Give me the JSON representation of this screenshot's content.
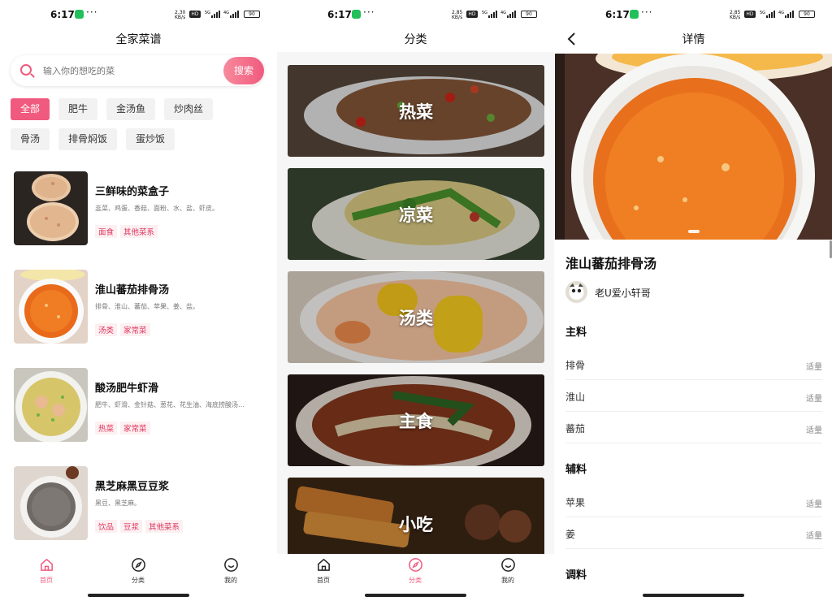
{
  "status": [
    {
      "time": "6:17",
      "dots": "···",
      "net": "2.30\nKB/s",
      "hd": "HD",
      "battery": "90",
      "sig1": "5G",
      "sig2": "4G"
    },
    {
      "time": "6:17",
      "dots": "···",
      "net": "2.85\nKB/s",
      "hd": "HD",
      "battery": "90",
      "sig1": "5G",
      "sig2": "4G"
    },
    {
      "time": "6:17",
      "dots": "···",
      "net": "2.85\nKB/s",
      "hd": "HD",
      "battery": "90",
      "sig1": "5G",
      "sig2": "4G"
    }
  ],
  "home": {
    "title": "全家菜谱",
    "search_placeholder": "输入你的想吃的菜",
    "search_button": "搜索",
    "chips": [
      "全部",
      "肥牛",
      "金汤鱼",
      "炒肉丝",
      "骨汤",
      "排骨焖饭",
      "蛋炒饭"
    ],
    "recipes": [
      {
        "name": "三鲜味的菜盒子",
        "ingredients": "韭菜、鸡蛋、香菇、面粉、水、盐、虾皮。",
        "tags": [
          "面食",
          "其他菜系"
        ]
      },
      {
        "name": "淮山蕃茄排骨汤",
        "ingredients": "排骨、淮山、蕃茄、苹果、姜、盐。",
        "tags": [
          "汤类",
          "家常菜"
        ]
      },
      {
        "name": "酸汤肥牛虾滑",
        "ingredients": "肥牛、虾滑、金针菇、葱花、花生油、海底捞酸汤…",
        "tags": [
          "热菜",
          "家常菜"
        ]
      },
      {
        "name": "黑芝麻黑豆豆浆",
        "ingredients": "黑豆、黑芝麻。",
        "tags": [
          "饮品",
          "豆浆",
          "其他菜系"
        ]
      }
    ]
  },
  "tabs": {
    "home": "首页",
    "category": "分类",
    "mine": "我的"
  },
  "category": {
    "title": "分类",
    "items": [
      "热菜",
      "凉菜",
      "汤类",
      "主食",
      "小吃"
    ]
  },
  "detail": {
    "title": "详情",
    "dish": "淮山蕃茄排骨汤",
    "author": "老U爱小轩哥",
    "main_label": "主料",
    "main": [
      {
        "name": "排骨",
        "amount": "适量"
      },
      {
        "name": "淮山",
        "amount": "适量"
      },
      {
        "name": "蕃茄",
        "amount": "适量"
      }
    ],
    "aux_label": "辅料",
    "aux": [
      {
        "name": "苹果",
        "amount": "适量"
      },
      {
        "name": "姜",
        "amount": "适量"
      }
    ],
    "season_label": "调料"
  },
  "colors": {
    "accent": "#f05a7e",
    "tag_bg": "#fdf0f2",
    "tag_text": "#e0365d"
  }
}
